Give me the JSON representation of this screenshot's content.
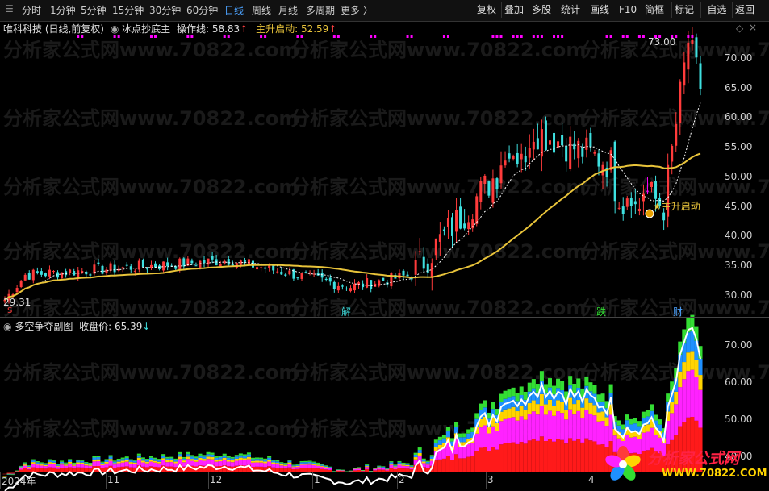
{
  "toolbar": {
    "periods": [
      "分时",
      "1分钟",
      "5分钟",
      "15分钟",
      "30分钟",
      "60分钟",
      "日线",
      "周线",
      "月线",
      "多周期",
      "更多 〉"
    ],
    "active_period": "日线",
    "right_buttons": [
      "复权",
      "叠加",
      "多股",
      "统计",
      "画线",
      "F10",
      "简框",
      "标记",
      "-自选",
      "返回"
    ]
  },
  "main_panel": {
    "stock_label": "唯科科技 (日线,前复权)",
    "indicator_name": "冰点抄底主",
    "line1_label": "操作线: 58.83",
    "line1_arrow": "↑",
    "line2_label": "主升启动: 52.59",
    "line2_arrow": "↑",
    "y_ticks": [
      "70.00",
      "65.00",
      "60.00",
      "55.00",
      "50.00",
      "45.00",
      "40.00",
      "35.00",
      "30.00"
    ],
    "high_label": "73.00",
    "low_label": "29.31",
    "signal_label": "★主升启动",
    "markers": {
      "jie": "解",
      "die": "跌",
      "cai": "财",
      "s_mark": "S"
    }
  },
  "sub_panel": {
    "indicator_name": "多空争夺副图",
    "close_label": "收盘价: 65.39",
    "close_arrow": "↓",
    "y_ticks": [
      "70.00",
      "60.00",
      "50.00",
      "40.00"
    ]
  },
  "x_axis": [
    "2024年",
    "11",
    "12",
    "1",
    "2",
    "3",
    "4"
  ],
  "watermark": {
    "text": "分析家公式网www.70822.com",
    "logo_cn": "分析家公式网",
    "logo_url": "WWW.70822.COM"
  },
  "colors": {
    "up": "#ff3b3b",
    "down": "#3ee0e0",
    "ma_yellow": "#e8c33a",
    "ma_white": "#ffffff",
    "magenta": "#ff00ff",
    "sub_red": "#ff1a1a",
    "sub_magenta": "#ff22ff",
    "sub_yellow": "#ffd400",
    "sub_blue": "#1e90ff",
    "sub_green": "#33dd33",
    "sub_line": "#ffffff",
    "toolbar_active": "#4da3ff"
  },
  "chart_data": {
    "type": "candlestick",
    "x": [
      "2024-10",
      "2024-11",
      "2024-12",
      "2025-01",
      "2025-02",
      "2025-03",
      "2025-04"
    ],
    "close_trend": [
      29.3,
      33.5,
      36.0,
      31.5,
      33.5,
      58.0,
      52.0,
      45.0,
      73.0,
      65.39
    ],
    "ylim_main": [
      27.5,
      74.5
    ],
    "ylim_sub": [
      36.0,
      74.5
    ],
    "last_close": 65.39,
    "high": 73.0,
    "low": 29.31
  }
}
